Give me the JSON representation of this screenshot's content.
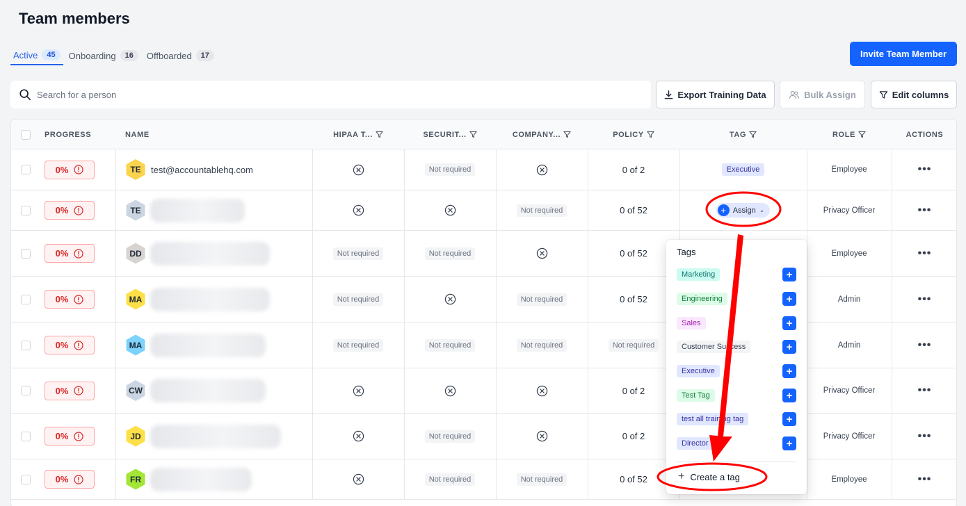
{
  "page": {
    "title": "Team members"
  },
  "tabs": [
    {
      "label": "Active",
      "count": "45"
    },
    {
      "label": "Onboarding",
      "count": "16"
    },
    {
      "label": "Offboarded",
      "count": "17"
    }
  ],
  "header": {
    "invite_label": "Invite Team Member"
  },
  "search": {
    "placeholder": "Search for a person"
  },
  "toolbar": {
    "export_label": "Export Training Data",
    "bulk_assign_label": "Bulk Assign",
    "edit_columns_label": "Edit columns"
  },
  "table": {
    "columns": {
      "progress": "PROGRESS",
      "name": "NAME",
      "hipaa": "HIPAA T...",
      "security": "SECURIT...",
      "company": "COMPANY...",
      "policy": "POLICY",
      "tag": "TAG",
      "role": "ROLE",
      "actions": "ACTIONS"
    },
    "rows": [
      {
        "progress": "0%",
        "initials": "TE",
        "avatar_color": "#fcd34d",
        "name": "test@accountablehq.com",
        "hipaa": "x",
        "security": "Not required",
        "company": "x",
        "policy": "0 of 2",
        "tag": "Executive",
        "role": "Employee"
      },
      {
        "progress": "0%",
        "initials": "TE",
        "avatar_color": "#cbd5e1",
        "name": "",
        "hipaa": "x",
        "security": "x",
        "company": "Not required",
        "policy": "0 of 52",
        "tag": "assign",
        "role": "Privacy Officer"
      },
      {
        "progress": "0%",
        "initials": "DD",
        "avatar_color": "#d6d3d1",
        "name": "",
        "hipaa": "Not required",
        "security": "Not required",
        "company": "x",
        "policy": "0 of 52",
        "tag": "",
        "role": "Employee"
      },
      {
        "progress": "0%",
        "initials": "MA",
        "avatar_color": "#fde047",
        "name": "",
        "hipaa": "Not required",
        "security": "x",
        "company": "Not required",
        "policy": "0 of 52",
        "tag": "",
        "role": "Admin"
      },
      {
        "progress": "0%",
        "initials": "MA",
        "avatar_color": "#7dd3fc",
        "name": "",
        "hipaa": "Not required",
        "security": "Not required",
        "company": "Not required",
        "policy": "Not required",
        "tag": "",
        "role": "Admin"
      },
      {
        "progress": "0%",
        "initials": "CW",
        "avatar_color": "#cbd5e1",
        "name": "",
        "hipaa": "x",
        "security": "x",
        "company": "x",
        "policy": "0 of 2",
        "tag": "",
        "role": "Privacy Officer"
      },
      {
        "progress": "0%",
        "initials": "JD",
        "avatar_color": "#fde047",
        "name": "",
        "hipaa": "x",
        "security": "Not required",
        "company": "x",
        "policy": "0 of 2",
        "tag": "",
        "role": "Privacy Officer"
      },
      {
        "progress": "0%",
        "initials": "FR",
        "avatar_color": "#a3e635",
        "name": "",
        "hipaa": "x",
        "security": "Not required",
        "company": "Not required",
        "policy": "0 of 52",
        "tag": "",
        "role": "Employee"
      }
    ]
  },
  "assign": {
    "label": "Assign"
  },
  "tags_menu": {
    "title": "Tags",
    "items": [
      {
        "label": "Marketing",
        "bg": "#ccfbf1",
        "fg": "#0f766e"
      },
      {
        "label": "Engineering",
        "bg": "#dcfce7",
        "fg": "#15803d"
      },
      {
        "label": "Sales",
        "bg": "#fae8ff",
        "fg": "#a21caf"
      },
      {
        "label": "Customer Success",
        "bg": "#f3f4f6",
        "fg": "#374151"
      },
      {
        "label": "Executive",
        "bg": "#e0e7ff",
        "fg": "#3730a3"
      },
      {
        "label": "Test Tag",
        "bg": "#dcfce7",
        "fg": "#15803d"
      },
      {
        "label": "test all training tag",
        "bg": "#e0e7ff",
        "fg": "#3730a3"
      },
      {
        "label": "Director",
        "bg": "#e0e7ff",
        "fg": "#3730a3"
      }
    ],
    "create_label": "Create a tag"
  },
  "colors": {
    "primary": "#1463ff",
    "danger": "#dc2626",
    "annotation": "#ff0000"
  }
}
